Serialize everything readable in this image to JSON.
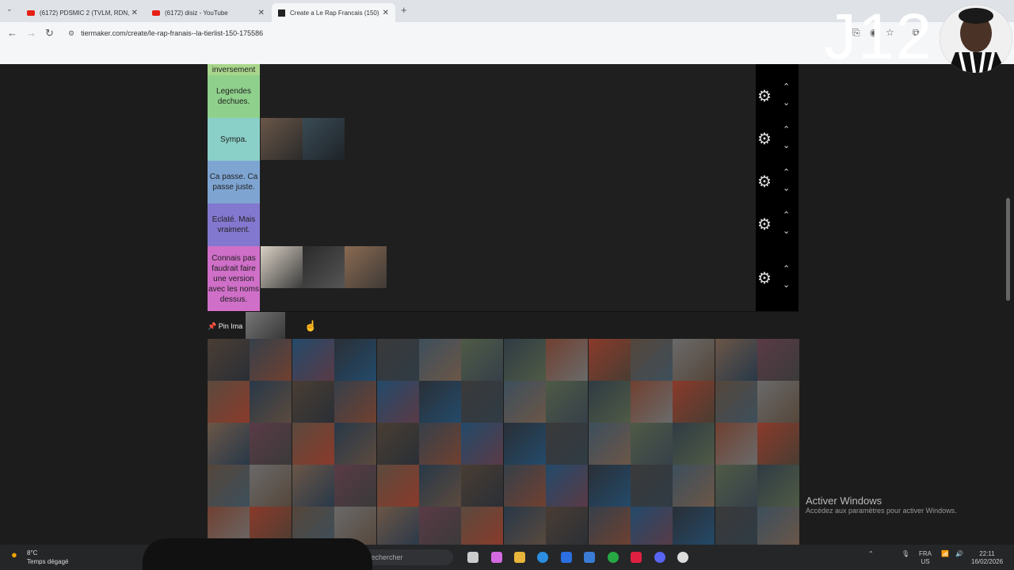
{
  "browser": {
    "tabs": [
      {
        "title": "(6172) PDSMIC 2 (TVLM, RDN,",
        "icon": "youtube-icon"
      },
      {
        "title": "(6172) disiz - YouTube",
        "icon": "youtube-icon"
      },
      {
        "title": "Create a Le Rap Francais (150)",
        "icon": "tiermaker-icon"
      }
    ],
    "new_tab": "+",
    "url": "tiermaker.com/create/le-rap-franais--la-tierlist-150-175586"
  },
  "overlay": {
    "text": "J12"
  },
  "tiers": [
    {
      "label": "inversement",
      "color": "#a9d68c"
    },
    {
      "label": "Legendes dechues.",
      "color": "#8fd18c"
    },
    {
      "label": "Sympa.",
      "color": "#8ad0c8"
    },
    {
      "label": "Ca passe. Ca passe juste.",
      "color": "#7ea5d2"
    },
    {
      "label": "Eclaté. Mais vraiment.",
      "color": "#8378cf"
    },
    {
      "label": "Connais pas faudrait faire une version avec les noms dessus.",
      "color": "#cf6fc8"
    }
  ],
  "pool": {
    "pin_label": "Pin Ima"
  },
  "activate_windows": {
    "title": "Activer Windows",
    "subtitle": "Accédez aux paramètres pour activer Windows."
  },
  "taskbar": {
    "temperature": "8°C",
    "weather": "Temps dégagé",
    "search_placeholder": "Rechercher",
    "lang": "FRA",
    "region": "US",
    "time": "22:11",
    "date": "16/02/2026"
  }
}
